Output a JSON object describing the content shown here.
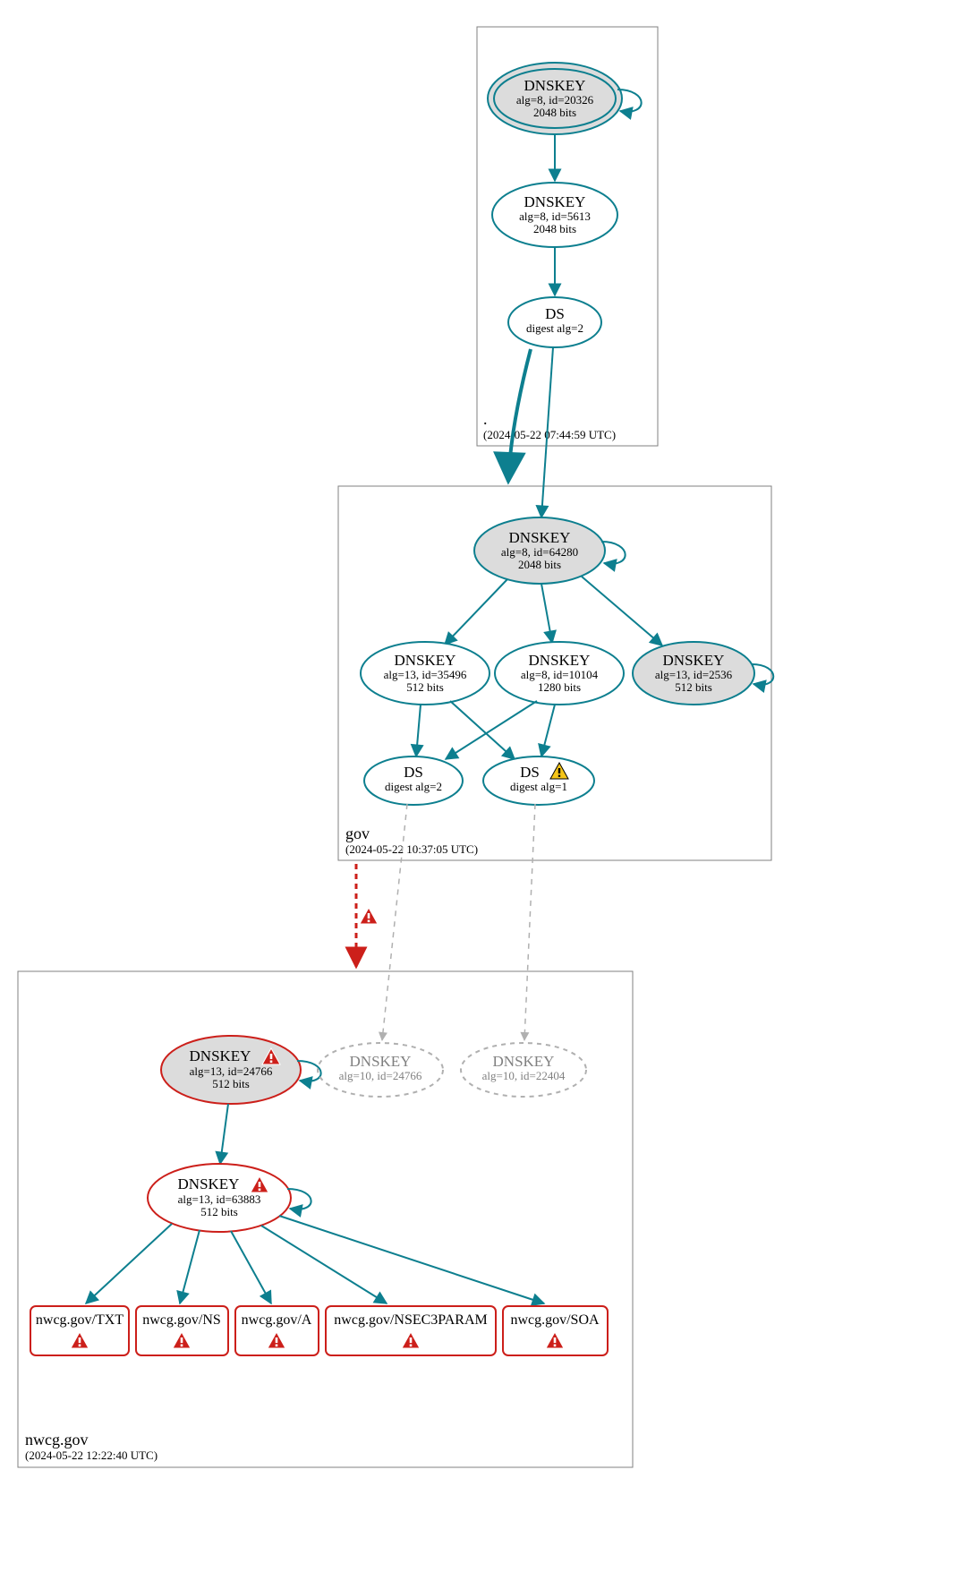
{
  "zones": {
    "root": {
      "name": ".",
      "time": "(2024-05-22 07:44:59 UTC)"
    },
    "gov": {
      "name": "gov",
      "time": "(2024-05-22 10:37:05 UTC)"
    },
    "nwcg": {
      "name": "nwcg.gov",
      "time": "(2024-05-22 12:22:40 UTC)"
    }
  },
  "nodes": {
    "root_ksk": {
      "title": "DNSKEY",
      "line2": "alg=8, id=20326",
      "line3": "2048 bits"
    },
    "root_zsk": {
      "title": "DNSKEY",
      "line2": "alg=8, id=5613",
      "line3": "2048 bits"
    },
    "root_ds": {
      "title": "DS",
      "line2": "digest alg=2"
    },
    "gov_ksk": {
      "title": "DNSKEY",
      "line2": "alg=8, id=64280",
      "line3": "2048 bits"
    },
    "gov_zsk13": {
      "title": "DNSKEY",
      "line2": "alg=13, id=35496",
      "line3": "512 bits"
    },
    "gov_zsk8": {
      "title": "DNSKEY",
      "line2": "alg=8, id=10104",
      "line3": "1280 bits"
    },
    "gov_sep13": {
      "title": "DNSKEY",
      "line2": "alg=13, id=2536",
      "line3": "512 bits"
    },
    "gov_ds2": {
      "title": "DS",
      "line2": "digest alg=2"
    },
    "gov_ds1": {
      "title": "DS",
      "line2": "digest alg=1"
    },
    "nwcg_ksk": {
      "title": "DNSKEY",
      "line2": "alg=13, id=24766",
      "line3": "512 bits"
    },
    "nwcg_zsk": {
      "title": "DNSKEY",
      "line2": "alg=13, id=63883",
      "line3": "512 bits"
    },
    "nwcg_gk1": {
      "title": "DNSKEY",
      "line2": "alg=10, id=24766"
    },
    "nwcg_gk2": {
      "title": "DNSKEY",
      "line2": "alg=10, id=22404"
    },
    "rr_txt": {
      "label": "nwcg.gov/TXT"
    },
    "rr_ns": {
      "label": "nwcg.gov/NS"
    },
    "rr_a": {
      "label": "nwcg.gov/A"
    },
    "rr_nsec": {
      "label": "nwcg.gov/NSEC3PARAM"
    },
    "rr_soa": {
      "label": "nwcg.gov/SOA"
    }
  },
  "colors": {
    "teal": "#0d7f8f",
    "red": "#cc1f1a",
    "grey": "#b0b0b0",
    "fill": "#dcdcdc"
  }
}
